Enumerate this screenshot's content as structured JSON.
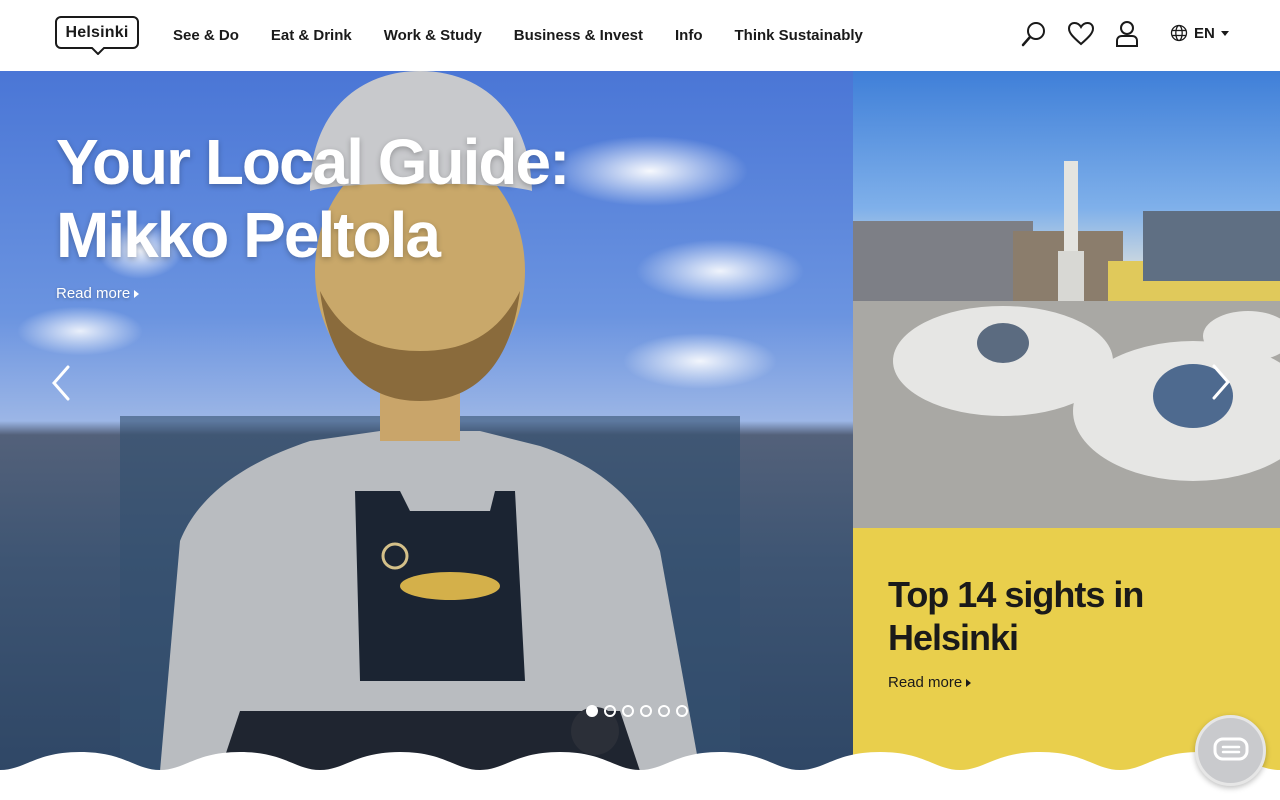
{
  "logo": {
    "text": "Helsinki"
  },
  "nav": {
    "items": [
      "See & Do",
      "Eat & Drink",
      "Work & Study",
      "Business & Invest",
      "Info",
      "Think Sustainably"
    ]
  },
  "header": {
    "icons": [
      "search-icon",
      "heart-icon",
      "user-icon",
      "globe-icon"
    ],
    "language": "EN"
  },
  "hero": {
    "title_line1": "Your Local Guide:",
    "title_line2": "Mikko Peltola",
    "read_more": "Read more",
    "slides_total": 6,
    "active_slide": 1
  },
  "side_card": {
    "title": "Top 14 sights in Helsinki",
    "read_more": "Read more",
    "color": "#e9cf4c"
  },
  "chat": {
    "icon": "chat-icon"
  }
}
